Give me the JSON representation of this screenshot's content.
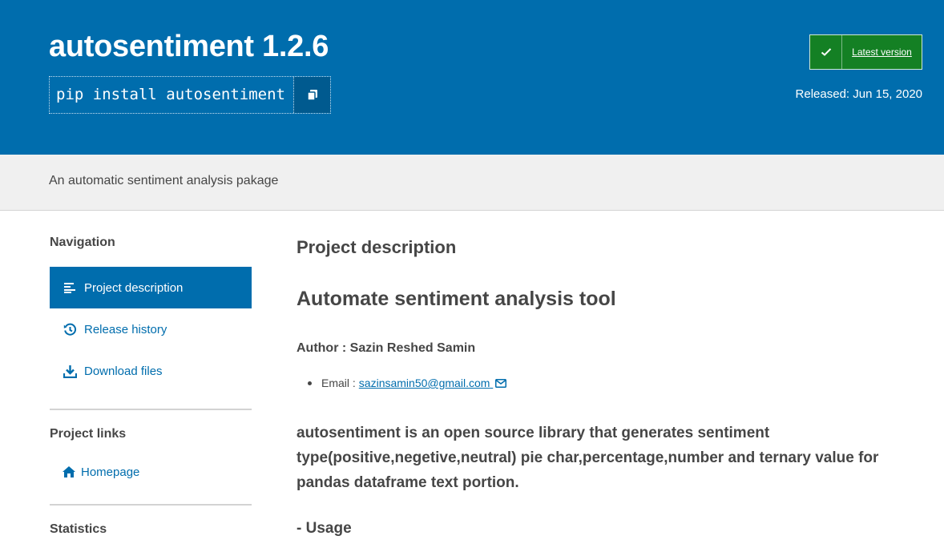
{
  "header": {
    "title": "autosentiment 1.2.6",
    "pip_command": "pip install autosentiment",
    "latest_label": "Latest version",
    "released": "Released: Jun 15, 2020"
  },
  "summary": "An automatic sentiment analysis pakage",
  "sidebar": {
    "navigation_heading": "Navigation",
    "nav_items": [
      {
        "label": "Project description",
        "icon": "align-left-icon",
        "active": true
      },
      {
        "label": "Release history",
        "icon": "history-icon",
        "active": false
      },
      {
        "label": "Download files",
        "icon": "download-icon",
        "active": false
      }
    ],
    "links_heading": "Project links",
    "homepage_label": "Homepage",
    "statistics_heading": "Statistics"
  },
  "content": {
    "section_title": "Project description",
    "heading": "Automate sentiment analysis tool",
    "author": "Author : Sazin Reshed Samin",
    "email_label": "Email :",
    "email": "sazinsamin50@gmail.com",
    "paragraph": "autosentiment is an open source library that generates sentiment type(positive,negetive,neutral) pie char,percentage,number and ternary value for pandas dataframe text portion.",
    "usage": "- Usage"
  },
  "colors": {
    "brand_blue": "#006dad",
    "latest_green": "#148024",
    "summary_bg": "#f0f0f0",
    "text": "#464646"
  }
}
